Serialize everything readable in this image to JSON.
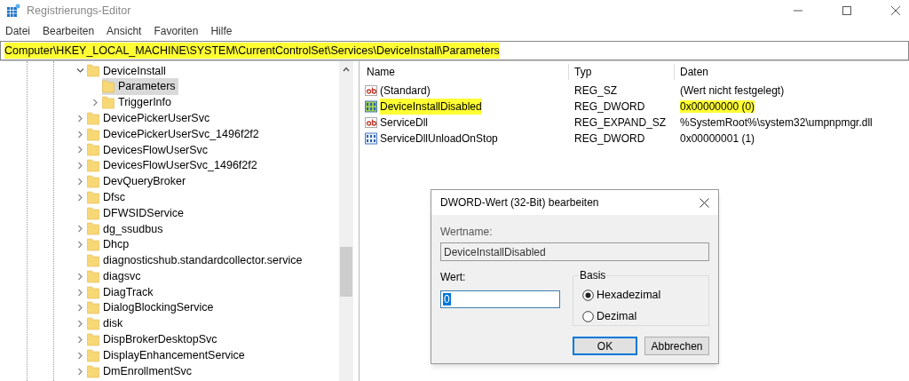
{
  "window": {
    "title": "Registrierungs-Editor"
  },
  "menu": [
    "Datei",
    "Bearbeiten",
    "Ansicht",
    "Favoriten",
    "Hilfe"
  ],
  "address_bar": {
    "value": "Computer\\HKEY_LOCAL_MACHINE\\SYSTEM\\CurrentControlSet\\Services\\DeviceInstall\\Parameters",
    "highlighted": true
  },
  "tree": {
    "items": [
      {
        "label": "DeviceInstall",
        "kind": "expanded",
        "selected": false,
        "children": [
          {
            "label": "Parameters",
            "kind": "leaf",
            "selected": true
          },
          {
            "label": "TriggerInfo",
            "kind": "collapsed",
            "selected": false
          }
        ]
      },
      {
        "label": "DevicePickerUserSvc",
        "kind": "collapsed",
        "selected": false
      },
      {
        "label": "DevicePickerUserSvc_1496f2f2",
        "kind": "collapsed",
        "selected": false
      },
      {
        "label": "DevicesFlowUserSvc",
        "kind": "collapsed",
        "selected": false
      },
      {
        "label": "DevicesFlowUserSvc_1496f2f2",
        "kind": "collapsed",
        "selected": false
      },
      {
        "label": "DevQueryBroker",
        "kind": "collapsed",
        "selected": false
      },
      {
        "label": "Dfsc",
        "kind": "collapsed",
        "selected": false
      },
      {
        "label": "DFWSIDService",
        "kind": "leaf",
        "selected": false
      },
      {
        "label": "dg_ssudbus",
        "kind": "collapsed",
        "selected": false
      },
      {
        "label": "Dhcp",
        "kind": "collapsed",
        "selected": false
      },
      {
        "label": "diagnosticshub.standardcollector.service",
        "kind": "leaf",
        "selected": false
      },
      {
        "label": "diagsvc",
        "kind": "collapsed",
        "selected": false
      },
      {
        "label": "DiagTrack",
        "kind": "collapsed",
        "selected": false
      },
      {
        "label": "DialogBlockingService",
        "kind": "collapsed",
        "selected": false
      },
      {
        "label": "disk",
        "kind": "collapsed",
        "selected": false
      },
      {
        "label": "DispBrokerDesktopSvc",
        "kind": "collapsed",
        "selected": false
      },
      {
        "label": "DisplayEnhancementService",
        "kind": "collapsed",
        "selected": false
      },
      {
        "label": "DmEnrollmentSvc",
        "kind": "collapsed",
        "selected": false
      }
    ]
  },
  "values": {
    "columns": [
      "Name",
      "Typ",
      "Daten"
    ],
    "rows": [
      {
        "name": "(Standard)",
        "kind": "string",
        "type": "REG_SZ",
        "data": "(Wert nicht festgelegt)",
        "highlighted": false
      },
      {
        "name": "DeviceInstallDisabled",
        "kind": "binary",
        "type": "REG_DWORD",
        "data": "0x00000000 (0)",
        "highlighted": true
      },
      {
        "name": "ServiceDll",
        "kind": "string",
        "type": "REG_EXPAND_SZ",
        "data": "%SystemRoot%\\system32\\umpnpmgr.dll",
        "highlighted": false
      },
      {
        "name": "ServiceDllUnloadOnStop",
        "kind": "binary",
        "type": "REG_DWORD",
        "data": "0x00000001 (1)",
        "highlighted": false
      }
    ]
  },
  "dialog": {
    "title": "DWORD-Wert (32-Bit) bearbeiten",
    "name_label": "Wertname:",
    "name_value": "DeviceInstallDisabled",
    "value_label": "Wert:",
    "value": "0",
    "base_label": "Basis",
    "bases": [
      {
        "label": "Hexadezimal",
        "selected": true
      },
      {
        "label": "Dezimal",
        "selected": false
      }
    ],
    "buttons": [
      {
        "label": "OK",
        "default": true
      },
      {
        "label": "Abbrechen",
        "default": false
      }
    ]
  }
}
